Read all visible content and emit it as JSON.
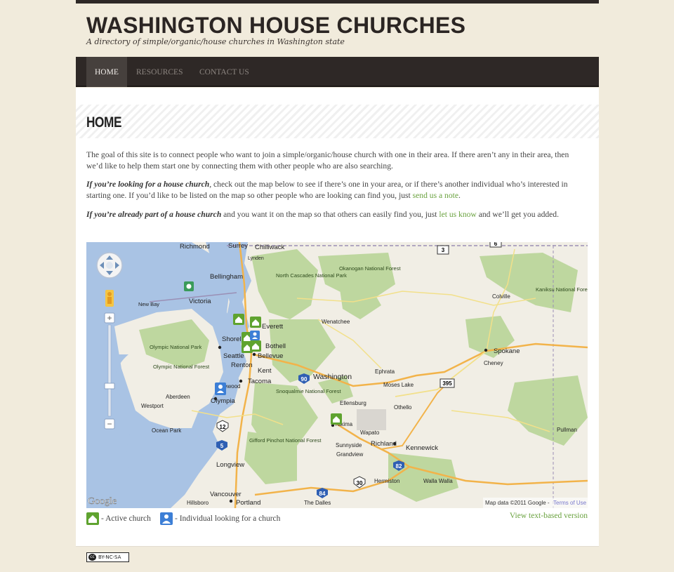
{
  "site": {
    "title": "WASHINGTON HOUSE CHURCHES",
    "tagline": "A directory of simple/organic/house churches in Washington state"
  },
  "nav": {
    "items": [
      {
        "label": "HOME",
        "active": true
      },
      {
        "label": "RESOURCES",
        "active": false
      },
      {
        "label": "CONTACT US",
        "active": false
      }
    ]
  },
  "page": {
    "title": "HOME",
    "intro": "The goal of this site is to connect people who want to join a simple/organic/house church with one in their area. If there aren’t any in their area, then we’d like to help them start one by connecting them with other people who are also searching.",
    "p2_lead": "If you’re looking for a house church",
    "p2_body": ", check out the map below to see if there’s one in your area, or if there’s another individual who’s interested in starting one. If you’d like to be listed on the map so other people who are looking can find you, just ",
    "p2_link": "send us a note",
    "p2_end": ".",
    "p3_lead": "If you’re already part of a house church",
    "p3_body": " and you want it on the map so that others can easily find you, just ",
    "p3_link": "let us know",
    "p3_end": " and we’ll get you added."
  },
  "map": {
    "labels": {
      "richmond": "Richmond",
      "surrey": "Surrey",
      "chilliwack": "Chilliwack",
      "bellingham": "Bellingham",
      "victoria": "Victoria",
      "new_bay": "New Bay",
      "olympic": "Olympic National Park",
      "olympic_forest": "Olympic National Forest",
      "seattle": "Seattle",
      "bellevue": "Bellevue",
      "renton": "Renton",
      "kent": "Kent",
      "tacoma": "Tacoma",
      "olympia": "Olympia",
      "shoreline": "Shoreline",
      "everett": "Everett",
      "bothell": "Bothell",
      "lakewood": "Lakewood",
      "aberdeen": "Aberdeen",
      "westport": "Westport",
      "ocean_park": "Ocean Park",
      "longview": "Longview",
      "vancouver": "Vancouver",
      "portland": "Portland",
      "hillsboro": "Hillsboro",
      "washington": "Washington",
      "spokane": "Spokane",
      "cheney": "Cheney",
      "wenatchee": "Wenatchee",
      "ellensburg": "Ellensburg",
      "yakima": "Yakima",
      "richland": "Richland",
      "kennewick": "Kennewick",
      "moses_lake": "Moses Lake",
      "othello": "Othello",
      "ephrata": "Ephrata",
      "okanogan": "Okanogan National Forest",
      "north_cascades": "North Cascades National Park",
      "colville": "Colville",
      "sunnyside": "Sunnyside",
      "grandview": "Grandview",
      "walla_walla": "Walla Walla",
      "pullman": "Pullman",
      "hermiston": "Hermiston",
      "the_dalles": "The Dalles",
      "gifford": "Gifford Pinchot National Forest",
      "snoqualmie": "Snoqualmie National Forest",
      "kaniksu": "Kaniksu National Forest",
      "lynden": "Lynden",
      "wapato": "Wapato"
    },
    "google_logo": "Google",
    "attribution": "Map data ©2011 Google -",
    "terms": "Terms of Use",
    "routes": [
      "3",
      "6",
      "12",
      "5",
      "82",
      "84",
      "90",
      "395",
      "30"
    ]
  },
  "legend": {
    "active": "- Active church",
    "individual": "- Individual looking for a church",
    "view_text": "View text-based version"
  },
  "footer": {
    "license": "BY-NC-SA",
    "cc": "cc"
  },
  "colors": {
    "active_church": "#5fa32f",
    "individual": "#3d7fd6",
    "link": "#6aa23f",
    "nav_bg": "#2e2826"
  }
}
